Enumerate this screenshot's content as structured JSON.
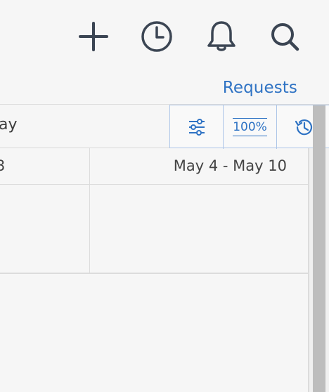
{
  "header": {
    "icons": [
      "plus-icon",
      "clock-icon",
      "bell-icon",
      "search-icon"
    ],
    "icon_color": "#3b4553"
  },
  "requests_link": "Requests",
  "toolbar": {
    "period_label": "ay",
    "zoom_label": "100%",
    "accent_color": "#2f73c4",
    "buttons": [
      "sliders-icon",
      "zoom-100",
      "history-icon"
    ]
  },
  "calendar": {
    "weeks": [
      {
        "label": "3"
      },
      {
        "label": "May 4 - May 10"
      }
    ]
  }
}
